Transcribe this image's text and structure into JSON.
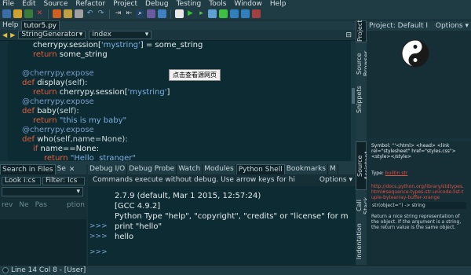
{
  "menu": [
    "File",
    "Edit",
    "Source",
    "Refactor",
    "Project",
    "Debug",
    "Testing",
    "Tools",
    "Window",
    "Help"
  ],
  "editor_tabs": {
    "help": "Help",
    "file": "tutor5.py"
  },
  "nav": {
    "scope": "StringGenerator",
    "symbol": "index"
  },
  "code_lines": [
    [
      [
        "cherrypy.session[",
        "id"
      ],
      [
        "'mystring'",
        "str"
      ],
      [
        "] = some_string",
        "id"
      ]
    ],
    [
      [
        "return ",
        "kw"
      ],
      [
        "some_string",
        "id"
      ]
    ],
    [],
    [
      [
        "@cherrypy.expose",
        "dec"
      ]
    ],
    [
      [
        "def ",
        "kw"
      ],
      [
        "display",
        "id"
      ],
      [
        "(self):",
        "plain"
      ]
    ],
    [
      [
        "return ",
        "kw"
      ],
      [
        "cherrypy.session[",
        "id"
      ],
      [
        "'mystring'",
        "str"
      ],
      [
        "]",
        "id"
      ]
    ],
    [
      [
        "@cherrypy.expose",
        "dec"
      ]
    ],
    [
      [
        "def ",
        "kw"
      ],
      [
        "baby",
        "id"
      ],
      [
        "(self):",
        "plain"
      ]
    ],
    [
      [
        "return ",
        "kw"
      ],
      [
        "\"this is my baby\"",
        "str"
      ]
    ],
    [
      [
        "@cherrypy.expose",
        "dec"
      ]
    ],
    [
      [
        "def ",
        "kw"
      ],
      [
        "who",
        "id"
      ],
      [
        "(self,name=None):",
        "plain"
      ]
    ],
    [
      [
        "if ",
        "kw"
      ],
      [
        "name==None:",
        "id"
      ]
    ],
    [
      [
        "return ",
        "kw"
      ],
      [
        "\"Hello  stranger\"",
        "str"
      ]
    ]
  ],
  "code_indent": [
    2,
    2,
    0,
    1,
    1,
    2,
    1,
    1,
    2,
    1,
    1,
    2,
    3
  ],
  "tooltip": "点击查看源网页",
  "left_panel": {
    "tabs": [
      "Search in Files",
      "Se"
    ],
    "look_in": "Look i:cs",
    "filter": "Filter: Ics",
    "results": [
      "rev",
      "Ne",
      "Pas",
      "ption"
    ]
  },
  "bottom_panel": {
    "tabs": [
      "Debug I/O",
      "Debug Probe",
      "Watch",
      "Modules",
      "Python Shell",
      "Bookmarks",
      "M"
    ],
    "active_tab": "Python Shell",
    "notice": "Commands execute without debug.  Use arrow keys for hi",
    "options": "Options",
    "prompts": [
      ">>>",
      ">>>",
      ">>>"
    ],
    "output": [
      "2.7.9 (default, Mar  1 2015, 12:57:24)",
      "[GCC 4.9.2]",
      "Python Type \"help\", \"copyright\", \"credits\" or \"license\" for m",
      "print  \"hello\"",
      "hello"
    ]
  },
  "status": "Line 14 Col 8 - [User]",
  "side_tabs_top": [
    "Project",
    "Source Browser",
    "Snippets"
  ],
  "side_tabs_bottom": [
    "Source Assistant",
    "Call Stack",
    "Indentation"
  ],
  "project_panel": {
    "title": "Project: Default I",
    "options": "Options"
  },
  "assistant": {
    "symbol_label": "Symbol:",
    "symbol_value": "'''<html> <head> <link rel=\"stylesheet\" href=\"styles.css\"> <style></style>",
    "type_label": "Type:",
    "type_value": "builtin str",
    "link": "http://docs.python.org/library/stdtypes.html#sequence-types-str-unicode-list-tuple-bytearray-buffer-xrange",
    "signature": "str(object='') -> string",
    "description": "Return a nice string representation of the object. If the argument is a string, the return value is the same object."
  }
}
